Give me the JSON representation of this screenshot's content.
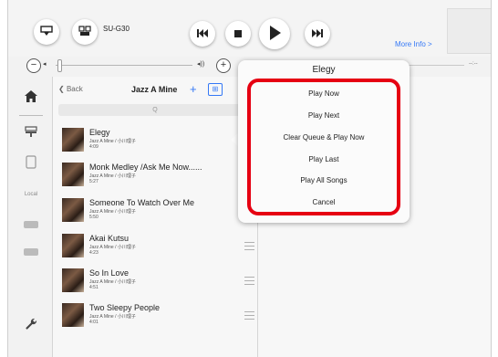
{
  "player": {
    "device_name": "SU-G30",
    "more_info": "More Info >",
    "time_remaining": "--:--"
  },
  "list": {
    "back_label": "Back",
    "title": "Jazz A Mine",
    "add_label": "+",
    "grid_label": "⊞",
    "search_glyph": "Q",
    "tracks": [
      {
        "title": "Elegy",
        "subtitle": "Jazz A Mine / 小川理子",
        "duration": "4:09"
      },
      {
        "title": "Monk Medley /Ask Me Now......",
        "subtitle": "Jazz A Mine / 小川理子",
        "duration": "5:27"
      },
      {
        "title": "Someone To Watch Over Me",
        "subtitle": "Jazz A Mine / 小川理子",
        "duration": "5:50"
      },
      {
        "title": "Akai Kutsu",
        "subtitle": "Jazz A Mine / 小川理子",
        "duration": "4:23"
      },
      {
        "title": "So In Love",
        "subtitle": "Jazz A Mine / 小川理子",
        "duration": "4:51"
      },
      {
        "title": "Two Sleepy People",
        "subtitle": "Jazz A Mine / 小川理子",
        "duration": "4:01"
      }
    ]
  },
  "popover": {
    "title": "Elegy",
    "items": [
      "Play Now",
      "Play Next",
      "Clear Queue & Play Now",
      "Play Last",
      "Play All Songs",
      "Cancel"
    ]
  },
  "sidebar": {
    "local_label": "Local"
  },
  "colors": {
    "accent": "#3478f6",
    "highlight": "#e60012"
  }
}
